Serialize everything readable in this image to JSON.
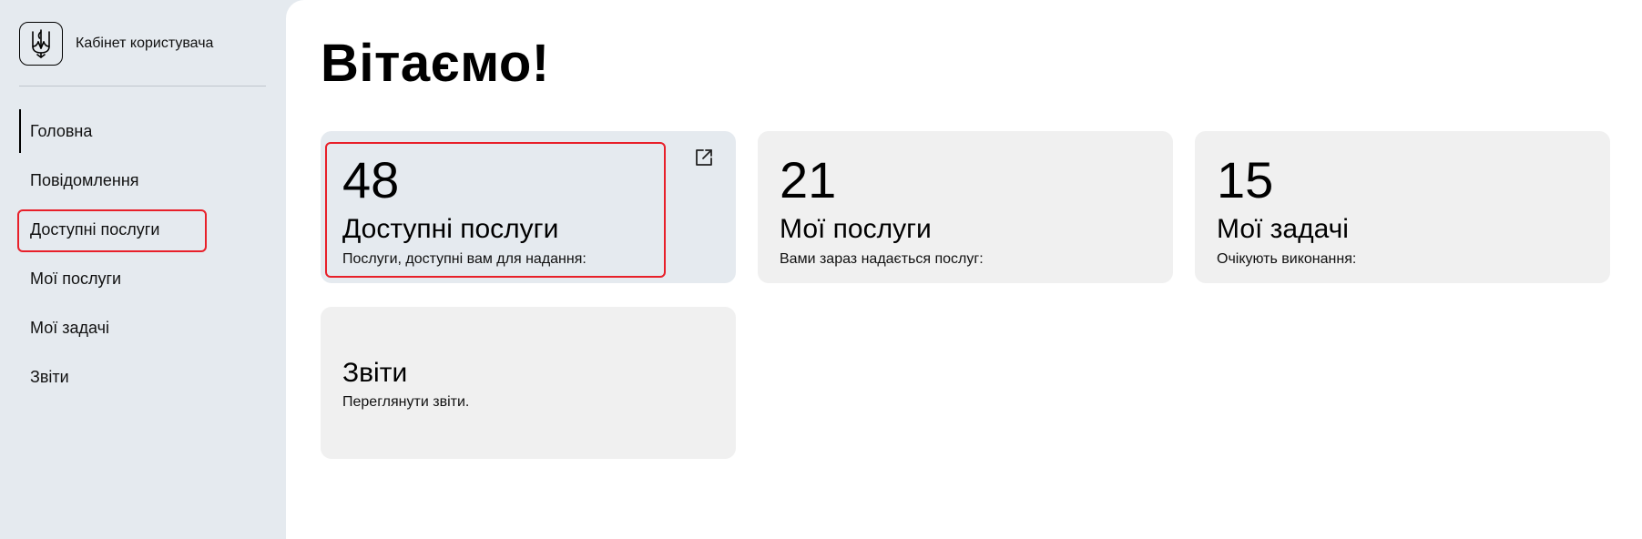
{
  "sidebar": {
    "brand": {
      "title": "Кабінет користувача",
      "logo_icon": "trident-icon"
    },
    "items": [
      {
        "label": "Головна",
        "active": true
      },
      {
        "label": "Повідомлення"
      },
      {
        "label": "Доступні послуги",
        "highlighted": true
      },
      {
        "label": "Мої послуги"
      },
      {
        "label": "Мої задачі"
      },
      {
        "label": "Звіти"
      }
    ]
  },
  "main": {
    "title": "Вітаємо!",
    "cards": [
      {
        "number": "48",
        "title": "Доступні послуги",
        "description": "Послуги, доступні вам для надання:",
        "icon": "external-link-icon",
        "highlighted": true
      },
      {
        "number": "21",
        "title": "Мої послуги",
        "description": "Вами зараз надається послуг:"
      },
      {
        "number": "15",
        "title": "Мої задачі",
        "description": "Очікують виконання:"
      },
      {
        "title": "Звіти",
        "description": "Переглянути звіти."
      }
    ]
  },
  "colors": {
    "sidebar_bg": "#e5eaef",
    "card_bg": "#f0f0f0",
    "highlight": "#e8202a",
    "text": "#000000"
  }
}
